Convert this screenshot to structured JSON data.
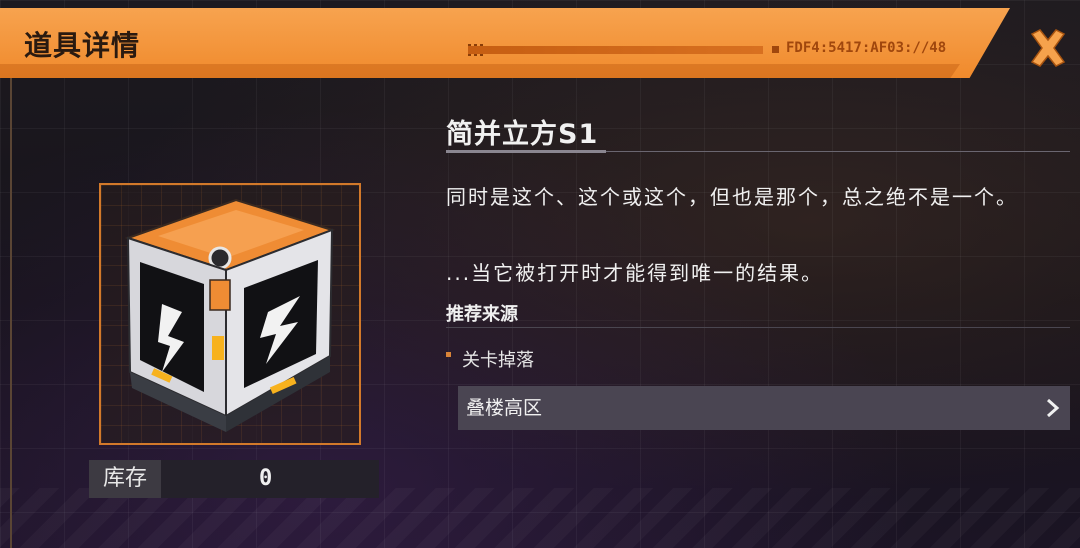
{
  "header": {
    "title": "道具详情",
    "code": "FDF4:5417:AF03://48",
    "close_icon": "close-x-icon",
    "accent_color": "#f39a3e"
  },
  "item": {
    "name": "简并立方S1",
    "image_icon": "orange-crate-s-icon",
    "description_lines": [
      "同时是这个、这个或这个，但也是那个，总之绝不是一个。",
      "...当它被打开时才能得到唯一的结果。"
    ]
  },
  "stock": {
    "label": "库存",
    "value": "0"
  },
  "source": {
    "section_title": "推荐来源",
    "type_label": "关卡掉落",
    "location_label": "叠楼高区",
    "location_icon": "chevron-right-icon"
  }
}
